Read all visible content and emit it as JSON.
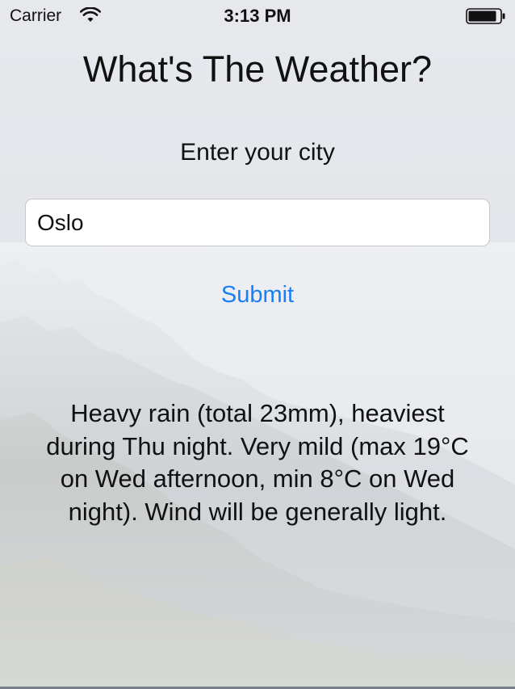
{
  "status_bar": {
    "carrier": "Carrier",
    "time": "3:13 PM",
    "icons": [
      "wifi-icon",
      "battery-icon"
    ]
  },
  "app": {
    "title": "What's The Weather?",
    "prompt": "Enter your city",
    "city_input": {
      "value": "Oslo",
      "placeholder": ""
    },
    "submit_label": "Submit",
    "forecast": "Heavy rain (total 23mm), heaviest during Thu night. Very mild (max 19°C on Wed afternoon, min 8°C on Wed night). Wind will be generally light."
  },
  "colors": {
    "accent": "#1a7ef6",
    "text": "#111111",
    "input_background": "#ffffff"
  }
}
